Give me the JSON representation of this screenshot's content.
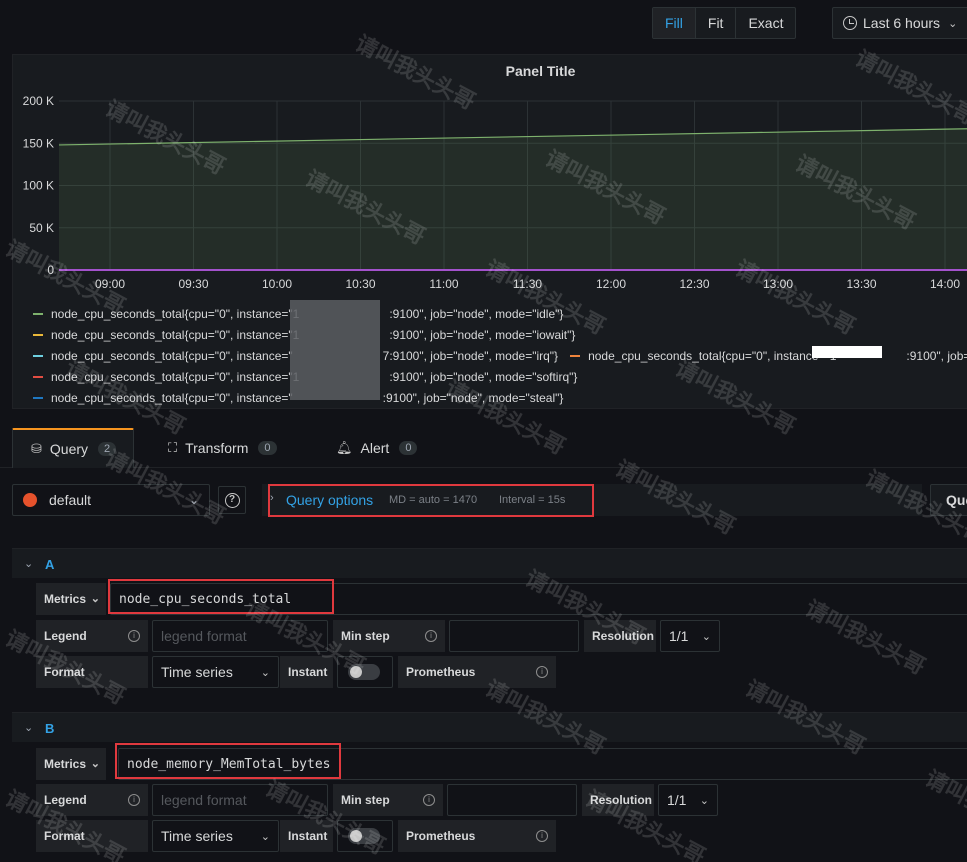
{
  "toolbar": {
    "zoom_modes": [
      "Fill",
      "Fit",
      "Exact"
    ],
    "active_mode": "Fill",
    "time_range": "Last 6 hours"
  },
  "panel": {
    "title": "Panel Title",
    "legend": [
      {
        "text": "node_cpu_seconds_total{cpu=\"0\", instance=\"1",
        "suffix": ":9100\", job=\"node\", mode=\"idle\"}",
        "color": "#7eb26d"
      },
      {
        "text": "node_cpu_seconds_total{cpu=\"0\", instance=\"1",
        "suffix": ":9100\", job=\"node\", mode=\"iowait\"}",
        "color": "#eab839"
      },
      {
        "text": "node_cpu_seconds_total{cpu=\"0\", instance=\"",
        "suffix": "7:9100\", job=\"node\", mode=\"irq\"}",
        "color": "#6ed0e0"
      },
      {
        "text": "node_cpu_seconds_total{cpu=\"0\", instance=\"1",
        "suffix": ":9100\", job=\"node\", mode=\"softirq\"}",
        "color": "#ef843c"
      },
      {
        "text": "node_cpu_seconds_total{cpu=\"0\", instance=\"",
        "suffix": ":9100\", job=\"node\", mode=\"steal\"}",
        "color": "#1f78c1"
      },
      {
        "text": "node_cpu_seconds_total{cpu=\"0\", instance=\"1",
        "suffix": ":9100\", job=\"",
        "color": "#e24d42"
      }
    ]
  },
  "chart_data": {
    "type": "line",
    "title": "Panel Title",
    "x_ticks": [
      "09:00",
      "09:30",
      "10:00",
      "10:30",
      "11:00",
      "11:30",
      "12:00",
      "12:30",
      "13:00",
      "13:30",
      "14:00"
    ],
    "y_ticks": [
      "0",
      "50 K",
      "100 K",
      "150 K",
      "200 K"
    ],
    "ylim": [
      0,
      200000
    ],
    "series": [
      {
        "name": "node_cpu_seconds_total{cpu=\"0\", mode=\"idle\"}",
        "color": "#7eb26d",
        "points": [
          [
            0,
            148000
          ],
          [
            10,
            168000
          ]
        ]
      },
      {
        "name": "node_cpu_seconds_total{cpu=\"0\", mode=\"iowait\"}",
        "color": "#eab839",
        "points": [
          [
            0,
            300
          ],
          [
            10,
            300
          ]
        ]
      },
      {
        "name": "node_cpu_seconds_total{cpu=\"0\", mode=\"irq\"}",
        "color": "#6ed0e0",
        "points": [
          [
            0,
            0
          ],
          [
            10,
            0
          ]
        ]
      },
      {
        "name": "node_cpu_seconds_total{cpu=\"0\", mode=\"softirq\"}",
        "color": "#e24d42",
        "points": [
          [
            0,
            200
          ],
          [
            10,
            200
          ]
        ]
      },
      {
        "name": "node_cpu_seconds_total{cpu=\"0\", mode=\"steal\"}",
        "color": "#1f78c1",
        "points": [
          [
            0,
            0
          ],
          [
            10,
            0
          ]
        ]
      }
    ],
    "grid": true
  },
  "tabs": [
    {
      "label": "Query",
      "count": "2"
    },
    {
      "label": "Transform",
      "count": "0"
    },
    {
      "label": "Alert",
      "count": "0"
    }
  ],
  "datasource": {
    "name": "default"
  },
  "query_options": {
    "label": "Query options",
    "md": "MD = auto = 1470",
    "interval": "Interval = 15s",
    "inspector_label": "Que"
  },
  "queries": [
    {
      "letter": "A",
      "metrics_label": "Metrics",
      "metric": "node_cpu_seconds_total",
      "legend_label": "Legend",
      "legend_placeholder": "legend format",
      "min_step_label": "Min step",
      "resolution_label": "Resolution",
      "resolution": "1/1",
      "format_label": "Format",
      "format": "Time series",
      "instant_label": "Instant",
      "prometheus_label": "Prometheus"
    },
    {
      "letter": "B",
      "metrics_label": "Metrics",
      "metric": "node_memory_MemTotal_bytes",
      "legend_label": "Legend",
      "legend_placeholder": "legend format",
      "min_step_label": "Min step",
      "resolution_label": "Resolution",
      "resolution": "1/1",
      "format_label": "Format",
      "format": "Time series",
      "instant_label": "Instant",
      "prometheus_label": "Prometheus"
    }
  ],
  "watermark": "请叫我头头哥"
}
